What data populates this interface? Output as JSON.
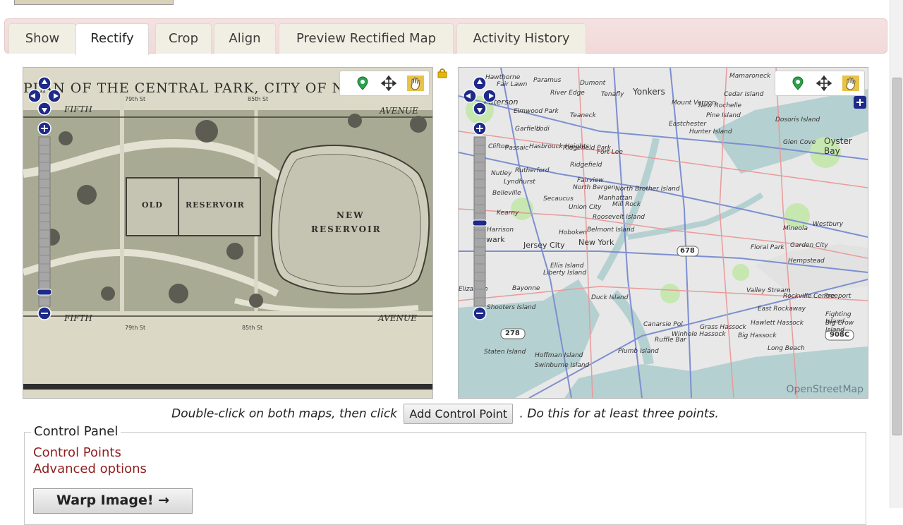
{
  "tabs": [
    {
      "label": "Show",
      "active": false
    },
    {
      "label": "Rectify",
      "active": true
    },
    {
      "label": "Crop",
      "active": false
    },
    {
      "label": "Align",
      "active": false
    },
    {
      "label": "Preview Rectified Map",
      "active": false
    },
    {
      "label": "Activity History",
      "active": false
    }
  ],
  "left_map": {
    "title_text": "PLAN OF THE CENTRAL PARK, CITY OF N",
    "labels": {
      "fifth_top": "FIFTH",
      "avenue_top": "AVENUE",
      "old": "OLD",
      "reservoir": "RESERVOIR",
      "new": "NEW",
      "new_reservoir": "RESERVOIR",
      "fifth_bottom": "FIFTH",
      "avenue_bottom": "AVENUE",
      "street_79_top": "79th St",
      "street_85_top": "85th St",
      "street_79_bottom": "79th St",
      "street_85_bottom": "85th St"
    },
    "colors": {
      "paper": "#d9d6c4",
      "ink": "#4a4a42",
      "park": "#a9aa93"
    }
  },
  "right_map": {
    "places": [
      "Hawthorne",
      "Paramus",
      "Dumont",
      "Yonkers",
      "Mamaroneck",
      "Fair Lawn",
      "River Edge",
      "Tenafly",
      "Cedar Island",
      "Paterson",
      "Mount Vernon",
      "New Rochelle",
      "Pine Island",
      "Teaneck",
      "Elmwood Park",
      "Garfield",
      "Lodi",
      "Eastchester",
      "Hunter Island",
      "Dosoris Island",
      "Oyster Bay",
      "Clifton",
      "Passaic",
      "Hasbrouck Heights",
      "Ridgefield Park",
      "Fort Lee",
      "Glen Cove",
      "Nutley",
      "Rutherford",
      "Lyndhurst",
      "Ridgefield",
      "Belleville",
      "Fairview",
      "North Bergen",
      "Manhattan",
      "North Brother Island",
      "Secaucus",
      "Mill Rock",
      "Kearny",
      "Union City",
      "Roosevelt Island",
      "Harrison",
      "Hoboken",
      "Belmont Island",
      "Newark",
      "Jersey City",
      "New York",
      "Mineola",
      "Westbury",
      "Floral Park",
      "Garden City",
      "Hempstead",
      "Ellis Island",
      "Liberty Island",
      "Bayonne",
      "Duck Island",
      "Valley Stream",
      "Rockville Centre",
      "Freeport",
      "East Rockaway",
      "Fighting Island",
      "Big Crow Island",
      "Shooters Island",
      "Grass Hassock",
      "Hawlett Hassock",
      "Canarsie Pol",
      "Winhole Hassock",
      "Big Hassock",
      "Ruffle Bar",
      "Staten Island",
      "Hoffman Island",
      "Swinburne Island",
      "Plumb Island",
      "Long Beach",
      "Elizabeth"
    ],
    "shields": [
      "678",
      "278",
      "908C"
    ],
    "attribution": "OpenStreetMap",
    "colors": {
      "land": "#e8e8e8",
      "water": "#b5d0d0",
      "roads_major": "#7d8fd0",
      "roads_minor": "#e99a9a",
      "park": "#c7e7b0"
    }
  },
  "icons": {
    "toolbar": [
      "add-point-icon",
      "move-icon",
      "pan-hand-icon"
    ],
    "zoom": [
      "pan-up-icon",
      "pan-left-icon",
      "pan-right-icon",
      "pan-down-icon",
      "zoom-in-icon",
      "zoom-out-icon"
    ],
    "lock": "lock-icon"
  },
  "instructions": {
    "before": "Double-click on both maps, then click",
    "button": "Add Control Point",
    "after": ". Do this for at least three points."
  },
  "control_panel": {
    "legend": "Control Panel",
    "links": [
      "Control Points",
      "Advanced options"
    ],
    "warp_button": "Warp Image! →"
  }
}
